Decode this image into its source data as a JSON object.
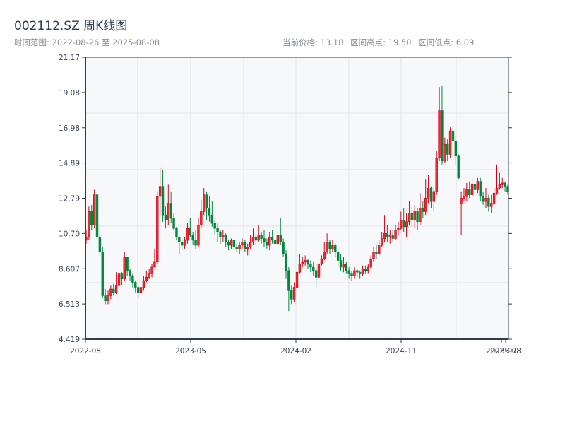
{
  "header": {
    "title": "002112.SZ 周K线图",
    "range_label": "时间范围: 2022-08-26 至 2025-08-08",
    "current_price": "当前价格: 13.18",
    "range_high": "区间高点: 19.50",
    "range_low": "区间低点: 6.09"
  },
  "chart_data": {
    "type": "candlestick",
    "title": "002112.SZ 周K线图",
    "frequency": "weekly",
    "x_start": "2022-08-26",
    "x_end": "2025-08-08",
    "x_tick_labels": [
      "2022-08",
      "2023-05",
      "2024-02",
      "2024-11",
      "2025-07",
      "2025-08"
    ],
    "y_tick_labels": [
      "4.419",
      "6.513",
      "8.607",
      "10.70",
      "12.79",
      "14.89",
      "16.98",
      "19.08",
      "21.17"
    ],
    "ylim": [
      4.419,
      21.17
    ],
    "grid": true,
    "colors": {
      "up": "#d0021b",
      "down": "#00873c",
      "plot_bg": "#f7f8fa",
      "axis": "#2c3e50",
      "grid": "#e1e4ea"
    },
    "candle_fields": [
      "open",
      "close",
      "high",
      "low"
    ],
    "candles": [
      [
        10.3,
        10.5,
        10.9,
        10.1
      ],
      [
        10.5,
        12.0,
        12.3,
        10.3
      ],
      [
        12.0,
        11.2,
        12.4,
        10.9
      ],
      [
        11.2,
        13.0,
        13.3,
        11.0
      ],
      [
        13.0,
        10.5,
        13.3,
        10.3
      ],
      [
        10.5,
        9.6,
        11.3,
        9.4
      ],
      [
        9.6,
        7.0,
        9.9,
        6.9
      ],
      [
        7.0,
        6.7,
        7.4,
        6.5
      ],
      [
        6.7,
        7.0,
        7.3,
        6.5
      ],
      [
        7.0,
        7.4,
        7.6,
        6.8
      ],
      [
        7.4,
        7.2,
        7.7,
        7.0
      ],
      [
        7.2,
        7.6,
        8.4,
        7.1
      ],
      [
        7.6,
        8.3,
        8.5,
        7.4
      ],
      [
        8.3,
        8.0,
        8.4,
        7.6
      ],
      [
        8.0,
        9.3,
        9.6,
        7.9
      ],
      [
        9.3,
        8.5,
        9.3,
        8.2
      ],
      [
        8.5,
        8.2,
        8.6,
        7.9
      ],
      [
        8.2,
        7.8,
        8.3,
        7.5
      ],
      [
        7.8,
        7.5,
        7.9,
        7.2
      ],
      [
        7.5,
        7.2,
        7.6,
        6.9
      ],
      [
        7.2,
        7.5,
        7.7,
        7.0
      ],
      [
        7.5,
        7.9,
        8.2,
        7.3
      ],
      [
        7.9,
        8.1,
        8.5,
        7.8
      ],
      [
        8.1,
        8.3,
        8.6,
        8.0
      ],
      [
        8.3,
        8.7,
        8.9,
        8.1
      ],
      [
        8.7,
        9.0,
        9.8,
        8.8
      ],
      [
        9.0,
        12.9,
        13.2,
        8.9
      ],
      [
        12.9,
        13.5,
        14.6,
        11.8
      ],
      [
        13.5,
        11.8,
        14.5,
        11.4
      ],
      [
        11.8,
        11.5,
        12.3,
        11.0
      ],
      [
        11.5,
        12.5,
        13.6,
        11.2
      ],
      [
        12.5,
        11.6,
        13.2,
        11.3
      ],
      [
        11.6,
        11.0,
        11.9,
        10.9
      ],
      [
        11.0,
        10.5,
        11.1,
        10.3
      ],
      [
        10.5,
        10.2,
        10.5,
        9.5
      ],
      [
        10.2,
        10.0,
        10.3,
        9.7
      ],
      [
        10.0,
        10.3,
        10.5,
        9.8
      ],
      [
        10.3,
        11.0,
        11.3,
        10.1
      ],
      [
        11.0,
        10.6,
        11.6,
        10.5
      ],
      [
        10.6,
        10.3,
        10.8,
        10.0
      ],
      [
        10.3,
        10.0,
        10.9,
        9.8
      ],
      [
        10.0,
        11.2,
        11.6,
        9.9
      ],
      [
        11.2,
        12.0,
        12.7,
        11.0
      ],
      [
        12.0,
        13.0,
        13.4,
        11.8
      ],
      [
        13.0,
        12.2,
        13.2,
        11.5
      ],
      [
        12.2,
        11.8,
        12.9,
        11.4
      ],
      [
        11.8,
        11.3,
        12.6,
        11.1
      ],
      [
        11.3,
        11.0,
        11.5,
        10.6
      ],
      [
        11.0,
        10.8,
        11.3,
        10.2
      ],
      [
        10.8,
        10.5,
        10.9,
        10.1
      ],
      [
        10.5,
        10.6,
        10.9,
        10.2
      ],
      [
        10.6,
        10.2,
        10.7,
        9.9
      ],
      [
        10.2,
        10.0,
        10.3,
        9.7
      ],
      [
        10.0,
        10.3,
        10.4,
        9.8
      ],
      [
        10.3,
        9.9,
        10.3,
        9.7
      ],
      [
        9.9,
        9.8,
        10.1,
        9.6
      ],
      [
        9.8,
        10.0,
        10.2,
        9.5
      ],
      [
        10.0,
        10.2,
        10.4,
        9.8
      ],
      [
        10.2,
        9.8,
        10.3,
        9.6
      ],
      [
        9.8,
        9.9,
        10.1,
        9.4
      ],
      [
        9.9,
        10.2,
        10.6,
        9.8
      ],
      [
        10.2,
        10.5,
        11.0,
        10.0
      ],
      [
        10.5,
        10.3,
        10.7,
        10.0
      ],
      [
        10.3,
        10.6,
        11.2,
        10.2
      ],
      [
        10.6,
        10.4,
        10.8,
        10.1
      ],
      [
        10.4,
        10.2,
        10.9,
        9.9
      ],
      [
        10.2,
        10.0,
        10.4,
        9.8
      ],
      [
        10.0,
        10.5,
        10.8,
        9.7
      ],
      [
        10.5,
        10.3,
        10.9,
        10.1
      ],
      [
        10.3,
        10.1,
        10.5,
        9.9
      ],
      [
        10.1,
        10.6,
        10.8,
        10.0
      ],
      [
        10.6,
        10.2,
        11.6,
        10.0
      ],
      [
        10.2,
        9.5,
        10.4,
        9.3
      ],
      [
        9.5,
        8.5,
        9.7,
        8.0
      ],
      [
        8.5,
        7.3,
        8.7,
        6.09
      ],
      [
        7.3,
        6.8,
        7.6,
        6.5
      ],
      [
        6.8,
        7.5,
        7.8,
        6.6
      ],
      [
        7.5,
        8.4,
        8.8,
        7.3
      ],
      [
        8.4,
        8.9,
        9.5,
        8.3
      ],
      [
        8.9,
        9.0,
        9.3,
        8.7
      ],
      [
        9.0,
        9.1,
        9.4,
        8.8
      ],
      [
        9.1,
        8.9,
        9.2,
        8.6
      ],
      [
        8.9,
        8.7,
        9.1,
        8.4
      ],
      [
        8.7,
        8.5,
        9.0,
        8.2
      ],
      [
        8.5,
        8.1,
        8.9,
        7.5
      ],
      [
        8.1,
        8.9,
        9.1,
        8.0
      ],
      [
        8.9,
        9.2,
        9.4,
        8.8
      ],
      [
        9.2,
        9.6,
        10.2,
        9.1
      ],
      [
        9.6,
        10.2,
        10.7,
        9.5
      ],
      [
        10.2,
        9.8,
        10.3,
        9.5
      ],
      [
        9.8,
        10.0,
        10.3,
        9.6
      ],
      [
        10.0,
        9.6,
        10.1,
        9.3
      ],
      [
        9.6,
        9.1,
        9.7,
        8.7
      ],
      [
        9.1,
        8.7,
        9.5,
        8.5
      ],
      [
        8.7,
        8.9,
        9.3,
        8.4
      ],
      [
        8.9,
        8.5,
        9.0,
        8.3
      ],
      [
        8.5,
        8.3,
        8.7,
        8.0
      ],
      [
        8.3,
        8.2,
        8.5,
        7.9
      ],
      [
        8.2,
        8.5,
        8.7,
        8.0
      ],
      [
        8.5,
        8.4,
        8.6,
        8.1
      ],
      [
        8.4,
        8.3,
        8.5,
        8.0
      ],
      [
        8.3,
        8.6,
        8.8,
        8.2
      ],
      [
        8.6,
        8.5,
        8.8,
        8.3
      ],
      [
        8.5,
        8.7,
        8.9,
        8.3
      ],
      [
        8.7,
        9.2,
        9.4,
        8.6
      ],
      [
        9.2,
        9.6,
        9.9,
        9.0
      ],
      [
        9.6,
        9.5,
        10.0,
        9.2
      ],
      [
        9.5,
        10.0,
        10.3,
        9.4
      ],
      [
        10.0,
        10.4,
        10.8,
        9.9
      ],
      [
        10.4,
        10.7,
        11.8,
        10.2
      ],
      [
        10.7,
        10.5,
        11.2,
        10.2
      ],
      [
        10.5,
        10.6,
        10.9,
        10.1
      ],
      [
        10.6,
        10.4,
        10.9,
        10.2
      ],
      [
        10.4,
        10.9,
        11.2,
        10.3
      ],
      [
        10.9,
        11.0,
        11.4,
        10.6
      ],
      [
        11.0,
        11.5,
        12.0,
        10.9
      ],
      [
        11.5,
        11.1,
        12.2,
        10.8
      ],
      [
        11.1,
        11.4,
        11.9,
        10.5
      ],
      [
        11.4,
        11.9,
        12.6,
        11.2
      ],
      [
        11.9,
        11.5,
        12.3,
        11.1
      ],
      [
        11.5,
        12.0,
        12.4,
        11.0
      ],
      [
        12.0,
        11.4,
        12.2,
        10.9
      ],
      [
        11.4,
        12.2,
        13.1,
        11.2
      ],
      [
        12.2,
        12.0,
        12.6,
        11.6
      ],
      [
        12.0,
        12.8,
        13.9,
        11.8
      ],
      [
        12.8,
        13.4,
        14.2,
        12.5
      ],
      [
        13.4,
        12.6,
        13.5,
        12.2
      ],
      [
        12.6,
        13.2,
        13.5,
        12.0
      ],
      [
        13.2,
        15.2,
        15.6,
        13.0
      ],
      [
        15.2,
        18.0,
        19.4,
        15.0
      ],
      [
        18.0,
        15.0,
        19.5,
        14.8
      ],
      [
        15.0,
        16.0,
        16.4,
        14.9
      ],
      [
        16.0,
        15.4,
        16.3,
        15.0
      ],
      [
        15.4,
        16.8,
        17.0,
        15.2
      ],
      [
        16.8,
        16.2,
        17.1,
        15.5
      ],
      [
        16.2,
        15.3,
        16.5,
        14.8
      ],
      [
        15.3,
        14.0,
        15.4,
        13.9
      ],
      [
        12.5,
        12.8,
        13.2,
        10.6
      ],
      [
        12.8,
        12.9,
        13.4,
        12.6
      ],
      [
        12.9,
        13.3,
        13.7,
        12.6
      ],
      [
        13.3,
        13.0,
        13.8,
        12.8
      ],
      [
        13.0,
        13.6,
        14.0,
        12.9
      ],
      [
        13.6,
        13.3,
        14.5,
        13.0
      ],
      [
        13.3,
        13.8,
        14.0,
        13.1
      ],
      [
        13.8,
        12.9,
        14.0,
        12.6
      ],
      [
        12.9,
        12.6,
        13.2,
        12.4
      ],
      [
        12.6,
        12.8,
        13.4,
        12.2
      ],
      [
        12.8,
        12.3,
        13.0,
        12.0
      ],
      [
        12.3,
        12.5,
        13.0,
        11.9
      ],
      [
        12.5,
        13.1,
        13.4,
        12.4
      ],
      [
        13.1,
        13.4,
        14.8,
        13.0
      ],
      [
        13.4,
        13.6,
        14.3,
        13.3
      ],
      [
        13.6,
        13.7,
        14.0,
        13.4
      ],
      [
        13.7,
        13.5,
        13.8,
        13.2
      ],
      [
        13.5,
        13.18,
        13.6,
        13.0
      ]
    ]
  }
}
